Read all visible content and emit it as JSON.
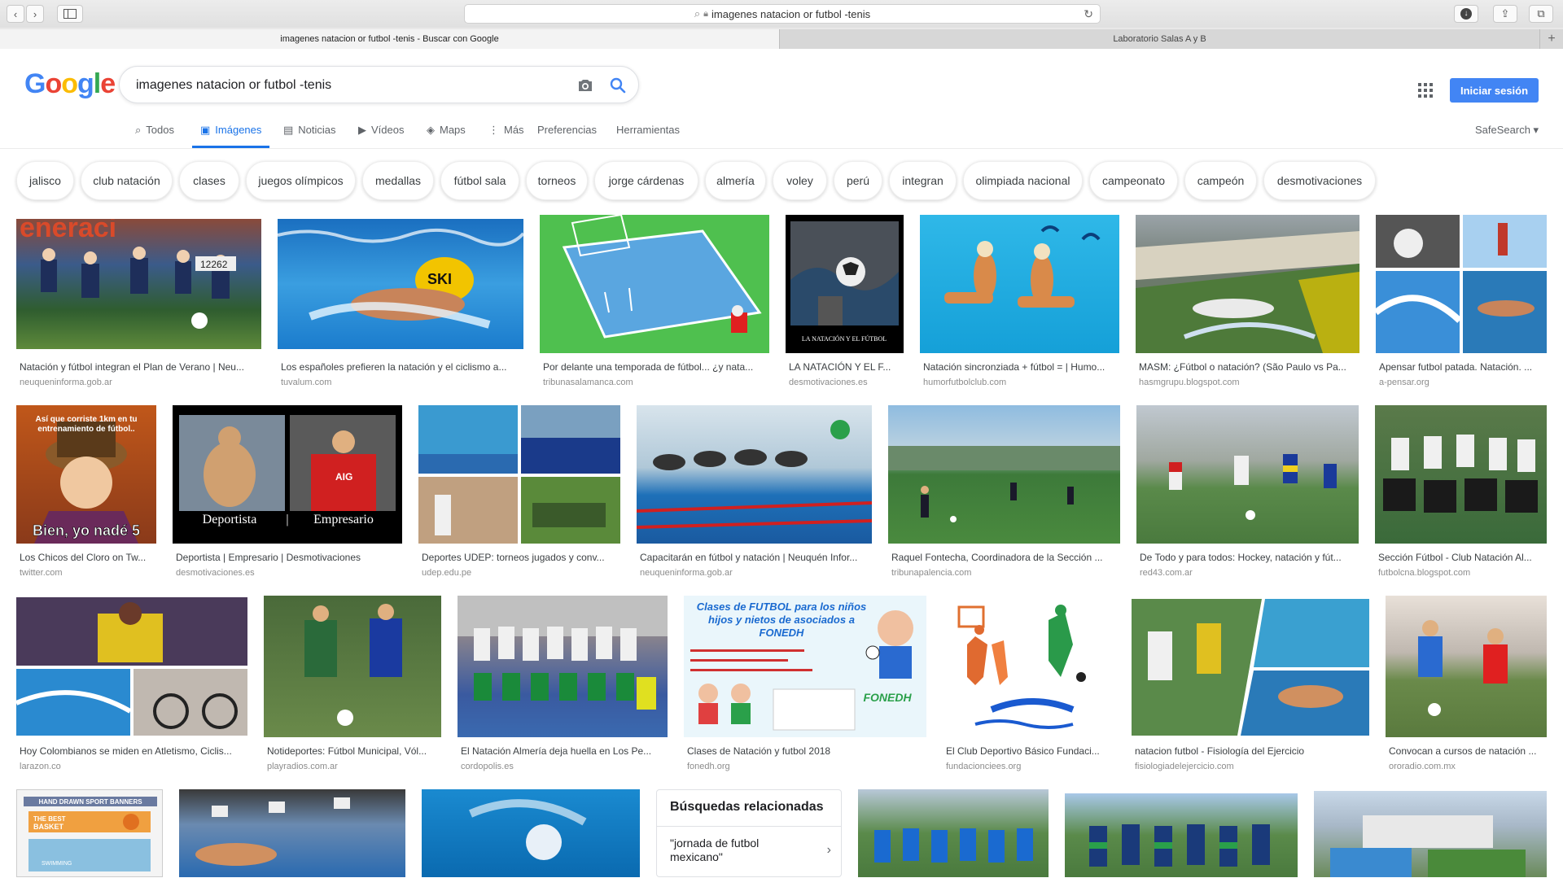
{
  "browser": {
    "url": "imagenes natacion or futbol -tenis",
    "tabs": [
      {
        "title": "imagenes natacion or futbol -tenis - Buscar con Google",
        "active": true
      },
      {
        "title": "Laboratorio Salas A y B",
        "active": false
      }
    ],
    "new_tab": "+"
  },
  "header": {
    "logo": "Google",
    "search_value": "imagenes natacion or futbol -tenis",
    "signin_label": "Iniciar sesión"
  },
  "nav": {
    "items": [
      {
        "label": "Todos",
        "icon": "search-icon"
      },
      {
        "label": "Imágenes",
        "icon": "image-icon"
      },
      {
        "label": "Noticias",
        "icon": "news-icon"
      },
      {
        "label": "Vídeos",
        "icon": "video-icon"
      },
      {
        "label": "Maps",
        "icon": "map-icon"
      },
      {
        "label": "Más",
        "icon": "more-icon"
      },
      {
        "label": "Preferencias"
      },
      {
        "label": "Herramientas"
      }
    ],
    "safesearch": "SafeSearch ▾"
  },
  "chips": [
    "jalisco",
    "club natación",
    "clases",
    "juegos olímpicos",
    "medallas",
    "fútbol sala",
    "torneos",
    "jorge cárdenas",
    "almería",
    "voley",
    "perú",
    "integran",
    "olimpiada nacional",
    "campeonato",
    "campeón",
    "desmotivaciones"
  ],
  "results": [
    {
      "caption": "Natación y fútbol integran el Plan de Verano | Neu...",
      "domain": "neuqueninforma.gob.ar"
    },
    {
      "caption": "Los españoles prefieren la natación y el ciclismo a...",
      "domain": "tuvalum.com"
    },
    {
      "caption": "Por delante una temporada de fútbol... ¿y nata...",
      "domain": "tribunasalamanca.com"
    },
    {
      "caption": "LA NATACIÓN Y EL F...",
      "domain": "desmotivaciones.es"
    },
    {
      "caption": "Natación sincronziada + fútbol = | Humo...",
      "domain": "humorfutbolclub.com"
    },
    {
      "caption": "MASM: ¿Fútbol o natación? (São Paulo vs Pa...",
      "domain": "hasmgrupu.blogspot.com"
    },
    {
      "caption": "Apensar futbol patada. Natación. ...",
      "domain": "a-pensar.org"
    },
    {
      "caption": "Los Chicos del Cloro on Tw...",
      "domain": "twitter.com"
    },
    {
      "caption": "Deportista | Empresario | Desmotivaciones",
      "domain": "desmotivaciones.es"
    },
    {
      "caption": "Deportes UDEP: torneos jugados y conv...",
      "domain": "udep.edu.pe"
    },
    {
      "caption": "Capacitarán en fútbol y natación | Neuquén Infor...",
      "domain": "neuqueninforma.gob.ar"
    },
    {
      "caption": "Raquel Fontecha, Coordinadora de la Sección ...",
      "domain": "tribunapalencia.com"
    },
    {
      "caption": "De Todo y para todos: Hockey, natación y fút...",
      "domain": "red43.com.ar"
    },
    {
      "caption": "Sección Fútbol - Club Natación Al...",
      "domain": "futbolcna.blogspot.com"
    },
    {
      "caption": "Hoy Colombianos se miden en Atletismo, Ciclis...",
      "domain": "larazon.co"
    },
    {
      "caption": "Notideportes: Fútbol Municipal, Vól...",
      "domain": "playradios.com.ar"
    },
    {
      "caption": "El Natación Almería deja huella en Los Pe...",
      "domain": "cordopolis.es"
    },
    {
      "caption": "Clases de Natación y futbol 2018",
      "domain": "fonedh.org"
    },
    {
      "caption": "El Club Deportivo Básico Fundaci...",
      "domain": "fundacionciees.org"
    },
    {
      "caption": "natacion futbol - Fisiología del Ejercicio",
      "domain": "fisiologiadelejercicio.com"
    },
    {
      "caption": "Convocan a cursos de natación ...",
      "domain": "ororadio.com.mx"
    }
  ],
  "image_text": {
    "meme1_top": "Así que corriste 1km en tu entrenamiento de fútbol..",
    "meme1_bottom": "Bien, yo nadé 5",
    "meme2_left": "Deportista",
    "meme2_right": "Empresario",
    "desmot_title": "LA NATACIÓN Y EL FÚTBOL",
    "fonedh_title": "Clases de FUTBOL para los niños hijos y nietos de asociados a FONEDH",
    "fonedh_logo": "FONEDH",
    "banner_title": "HAND DRAWN SPORT BANNERS",
    "banner_basket": "THE BEST BASKET",
    "banner_swim": "SWIMMING"
  },
  "related": {
    "title": "Búsquedas relacionadas",
    "item": "\"jornada de futbol mexicano\"",
    "chevron": "›"
  },
  "colors": {
    "google_blue": "#4285f4",
    "google_red": "#ea4335",
    "google_yellow": "#fbbc05",
    "google_green": "#34a853",
    "active_tab": "#1a73e8"
  }
}
